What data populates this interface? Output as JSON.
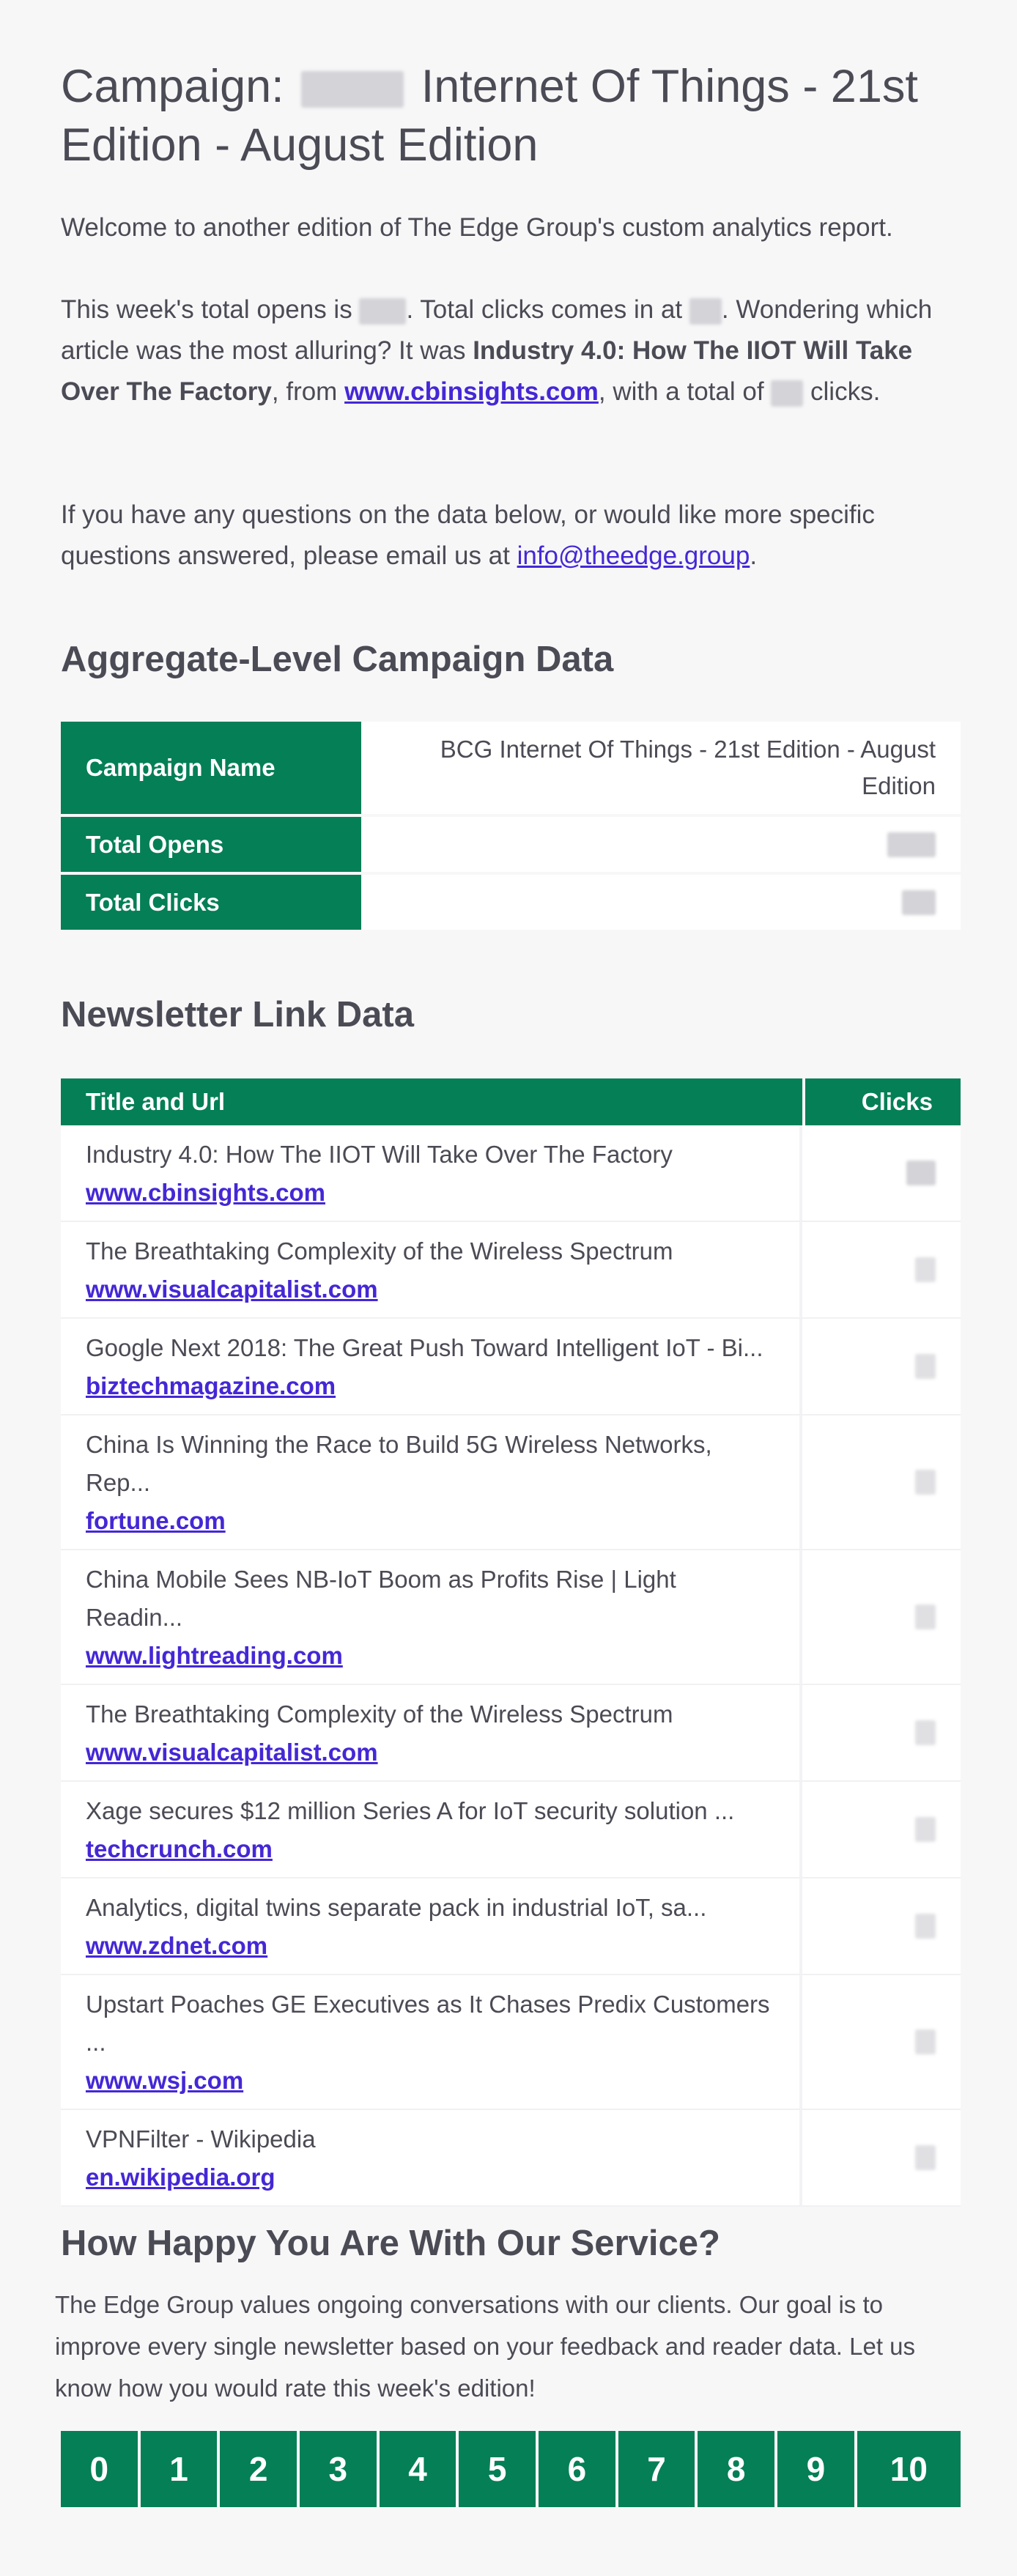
{
  "header": {
    "title_prefix": "Campaign:",
    "title_suffix": "Internet Of Things - 21st Edition - August Edition"
  },
  "intro": {
    "welcome": "Welcome to another edition of The Edge Group's custom analytics report.",
    "opens_prefix": "This week's total opens is",
    "clicks_prefix": ". Total clicks comes in at",
    "question": ". Wondering which article was the most alluring? It was",
    "top_article": "Industry 4.0: How The IIOT Will Take Over The Factory",
    "from_text": ", from",
    "top_domain": "www.cbinsights.com",
    "total_of_text": ", with a total of",
    "clicks_suffix": "clicks.",
    "contact_text": "If you have any questions on the data below, or would like more specific questions answered, please email us at",
    "contact_email": "info@theedge.group",
    "contact_end": "."
  },
  "aggregate": {
    "heading": "Aggregate-Level Campaign Data",
    "rows": [
      {
        "label": "Campaign Name",
        "value": "BCG Internet Of Things - 21st Edition - August Edition"
      },
      {
        "label": "Total Opens",
        "value": ""
      },
      {
        "label": "Total Clicks",
        "value": ""
      }
    ]
  },
  "links": {
    "heading": "Newsletter Link Data",
    "col_title": "Title and Url",
    "col_clicks": "Clicks",
    "rows": [
      {
        "title": "Industry 4.0: How The IIOT Will Take Over The Factory",
        "url": "www.cbinsights.com"
      },
      {
        "title": "The Breathtaking Complexity of the Wireless Spectrum",
        "url": "www.visualcapitalist.com"
      },
      {
        "title": "Google Next 2018: The Great Push Toward Intelligent IoT - Bi...",
        "url": "biztechmagazine.com"
      },
      {
        "title": "China Is Winning the Race to Build 5G Wireless Networks, Rep...",
        "url": "fortune.com"
      },
      {
        "title": "China Mobile Sees NB-IoT Boom as Profits Rise | Light Readin...",
        "url": "www.lightreading.com"
      },
      {
        "title": "The Breathtaking Complexity of the Wireless Spectrum",
        "url": "www.visualcapitalist.com"
      },
      {
        "title": "Xage secures $12 million Series A for IoT security solution ...",
        "url": "techcrunch.com"
      },
      {
        "title": "Analytics, digital twins separate pack in industrial IoT, sa...",
        "url": "www.zdnet.com"
      },
      {
        "title": "Upstart Poaches GE Executives as It Chases Predix Customers ...",
        "url": "www.wsj.com"
      },
      {
        "title": "VPNFilter - Wikipedia",
        "url": "en.wikipedia.org"
      }
    ]
  },
  "rating": {
    "heading": "How Happy You Are With Our Service?",
    "text": "The Edge Group values ongoing conversations with our clients. Our goal is to improve every single newsletter based on your feedback and reader data. Let us know how you would rate this week's edition!",
    "options": [
      "0",
      "1",
      "2",
      "3",
      "4",
      "5",
      "6",
      "7",
      "8",
      "9",
      "10"
    ]
  },
  "colors": {
    "brand_green": "#057f56",
    "link_purple": "#4527d6",
    "text": "#4b4b55",
    "background": "#f7f7f8"
  }
}
